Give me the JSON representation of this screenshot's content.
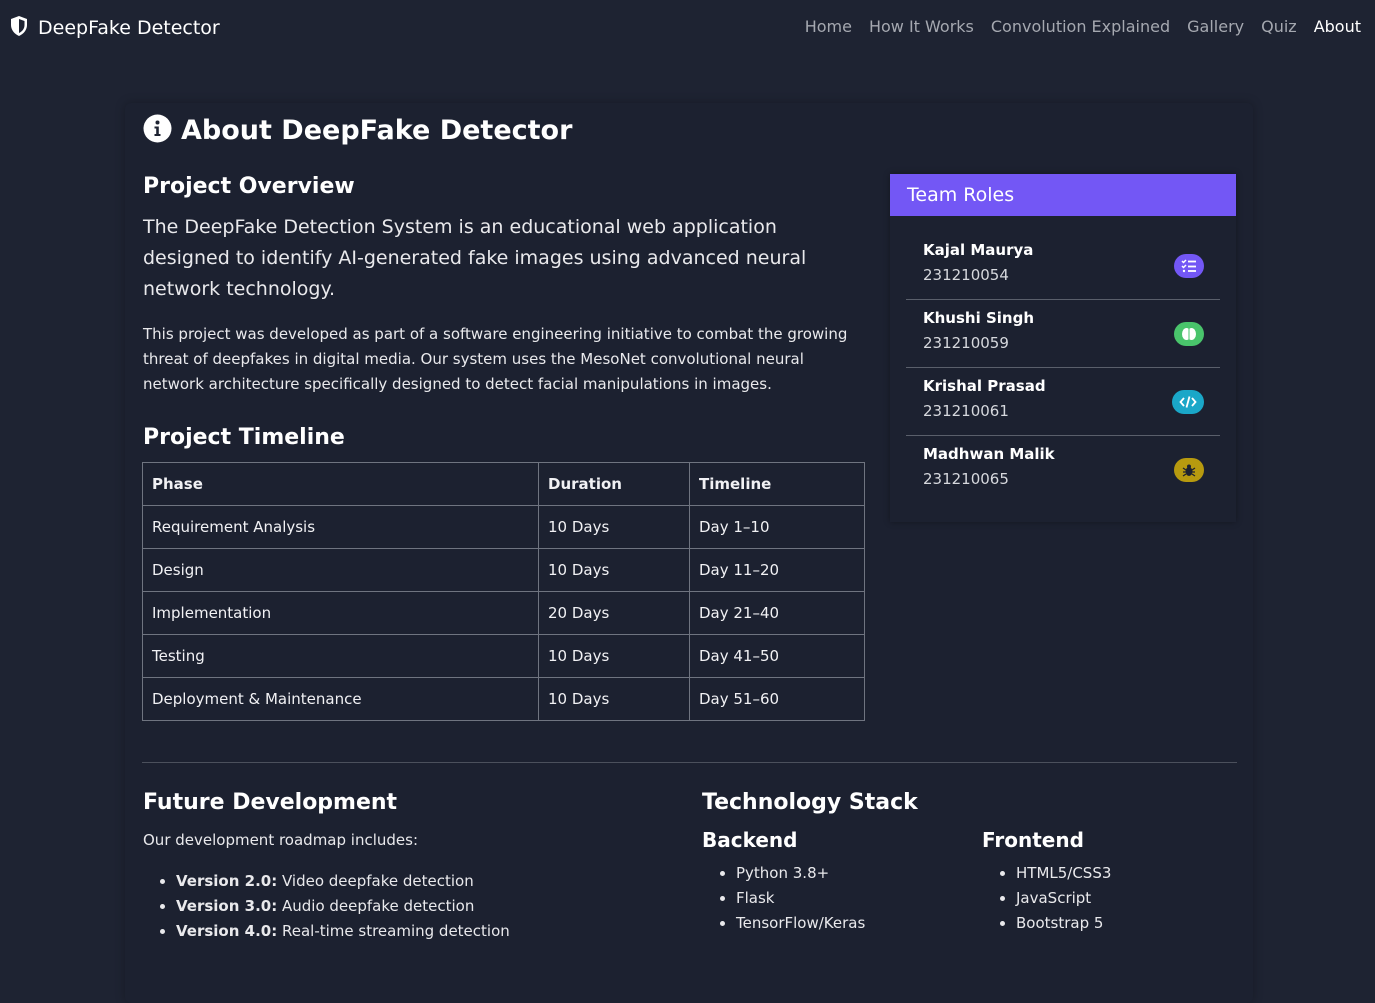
{
  "navbar": {
    "brand": "DeepFake Detector",
    "links": [
      "Home",
      "How It Works",
      "Convolution Explained",
      "Gallery",
      "Quiz",
      "About"
    ],
    "active": "About"
  },
  "page": {
    "title": "About DeepFake Detector"
  },
  "overview": {
    "heading": "Project Overview",
    "lead": "The DeepFake Detection System is an educational web application designed to identify AI-generated fake images using advanced neural network technology.",
    "paragraph": "This project was developed as part of a software engineering initiative to combat the growing threat of deepfakes in digital media. Our system uses the MesoNet convolutional neural network architecture specifically designed to detect facial manipulations in images."
  },
  "timeline": {
    "heading": "Project Timeline",
    "columns": [
      "Phase",
      "Duration",
      "Timeline"
    ],
    "rows": [
      [
        "Requirement Analysis",
        "10 Days",
        "Day 1–10"
      ],
      [
        "Design",
        "10 Days",
        "Day 11–20"
      ],
      [
        "Implementation",
        "20 Days",
        "Day 21–40"
      ],
      [
        "Testing",
        "10 Days",
        "Day 41–50"
      ],
      [
        "Deployment & Maintenance",
        "10 Days",
        "Day 51–60"
      ]
    ]
  },
  "team": {
    "heading": "Team Roles",
    "members": [
      {
        "name": "Kajal Maurya",
        "id": "231210054",
        "icon": "list-check-icon",
        "color": "#7357f5"
      },
      {
        "name": "Khushi Singh",
        "id": "231210059",
        "icon": "brain-icon",
        "color": "#49c46b"
      },
      {
        "name": "Krishal Prasad",
        "id": "231210061",
        "icon": "code-icon",
        "color": "#1aa7c8"
      },
      {
        "name": "Madhwan Malik",
        "id": "231210065",
        "icon": "bug-icon",
        "color": "#b79a0f"
      }
    ]
  },
  "future": {
    "heading": "Future Development",
    "intro": "Our development roadmap includes:",
    "items": [
      {
        "version": "Version 2.0:",
        "text": " Video deepfake detection"
      },
      {
        "version": "Version 3.0:",
        "text": " Audio deepfake detection"
      },
      {
        "version": "Version 4.0:",
        "text": " Real-time streaming detection"
      }
    ]
  },
  "stack": {
    "heading": "Technology Stack",
    "backend": {
      "heading": "Backend",
      "items": [
        "Python 3.8+",
        "Flask",
        "TensorFlow/Keras"
      ]
    },
    "frontend": {
      "heading": "Frontend",
      "items": [
        "HTML5/CSS3",
        "JavaScript",
        "Bootstrap 5"
      ]
    }
  }
}
